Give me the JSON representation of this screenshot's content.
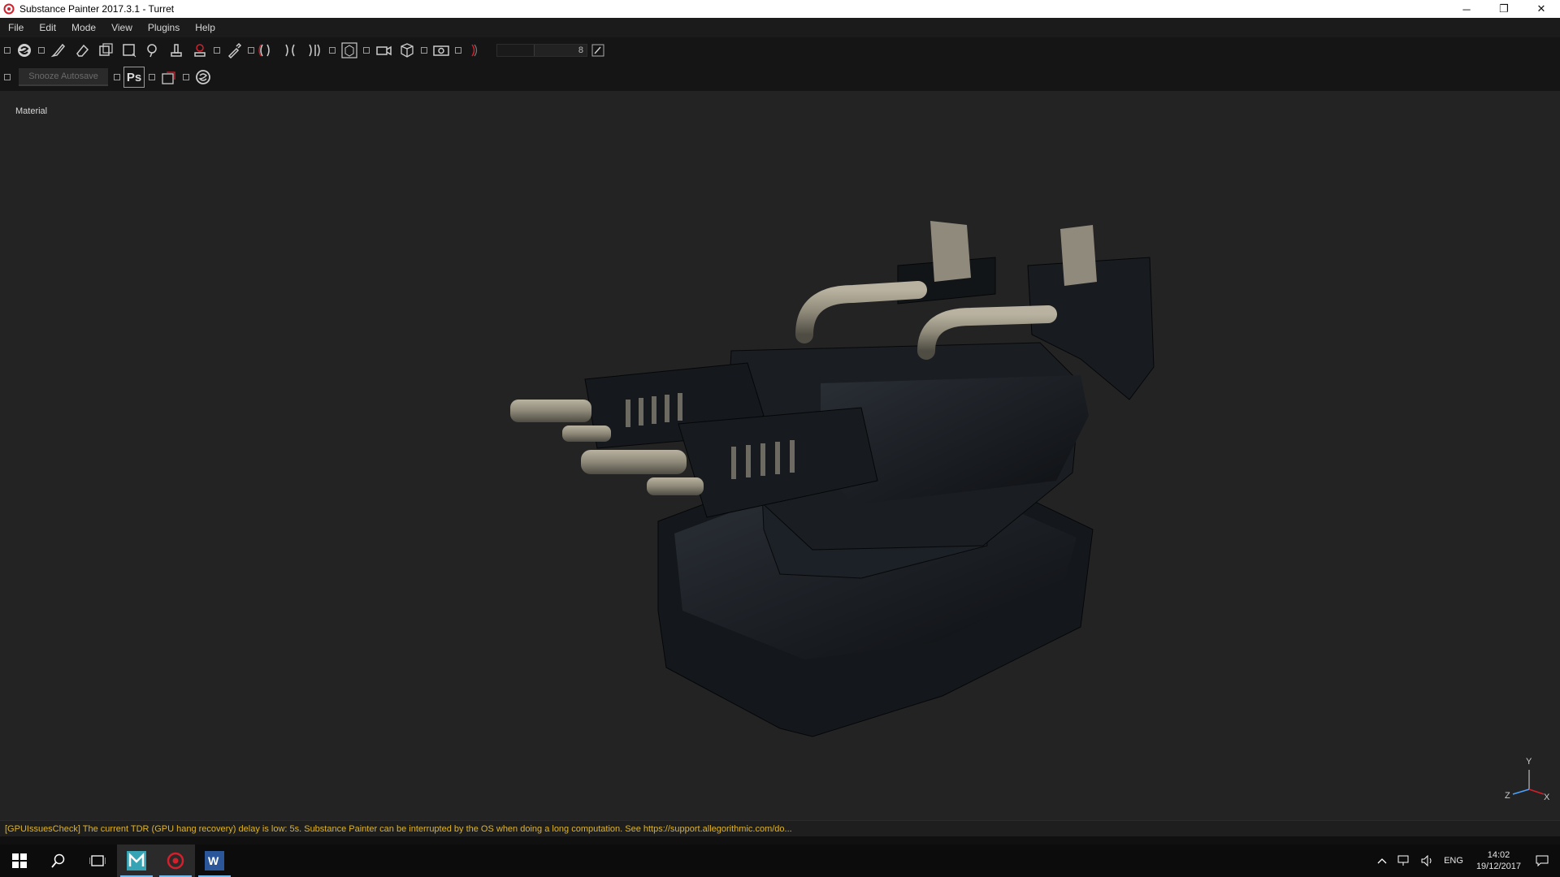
{
  "window": {
    "title": "Substance Painter 2017.3.1 - Turret",
    "minimize": "─",
    "restore": "❐",
    "close": "✕"
  },
  "menu": [
    "File",
    "Edit",
    "Mode",
    "View",
    "Plugins",
    "Help"
  ],
  "toolbar": {
    "icons": [
      "substance-logo-icon",
      "paint-brush-icon",
      "eraser-icon",
      "projection-icon",
      "polygon-fill-icon",
      "smudge-icon",
      "clone-stamp-icon",
      "material-picker-icon",
      "pipette-icon",
      "symmetry-icon",
      "camera-view-icon",
      "render-icon"
    ],
    "brush_size_value": "8"
  },
  "toolbar2": {
    "snooze_label": "Snooze Autosave",
    "ps_label": "Ps"
  },
  "viewport": {
    "label": "Material",
    "axis": {
      "y": "Y",
      "x": "X",
      "z": "Z"
    }
  },
  "status": {
    "message": "[GPUIssuesCheck] The current TDR (GPU hang recovery) delay is low: 5s. Substance Painter can be interrupted by the OS when doing a long computation. See https://support.allegorithmic.com/do...",
    "color": "#e0b426"
  },
  "taskbar": {
    "apps": [
      "maya-icon",
      "substance-painter-icon",
      "word-icon"
    ],
    "lang": "ENG",
    "time": "14:02",
    "date": "19/12/2017"
  }
}
